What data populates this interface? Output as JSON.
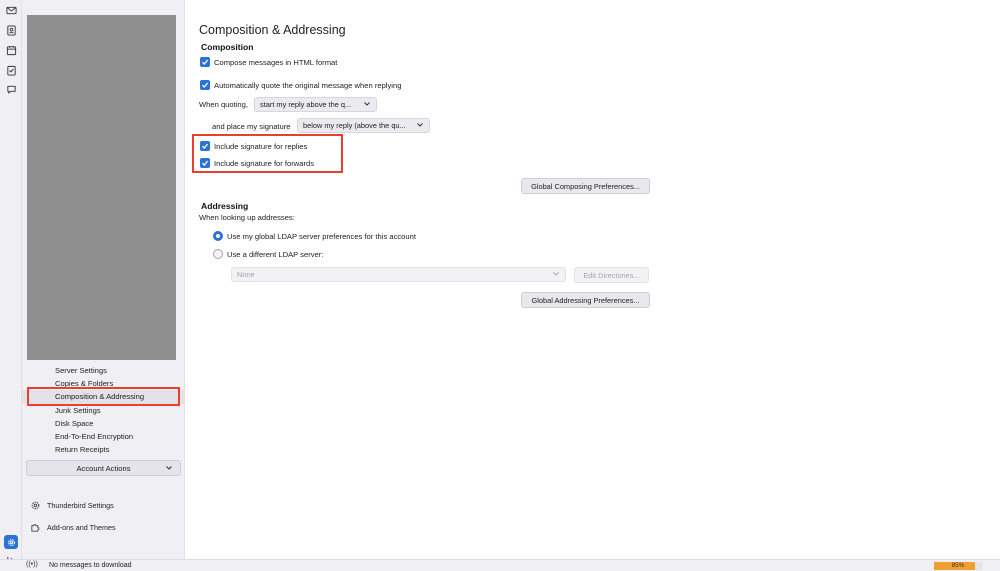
{
  "spaces": {
    "items": [
      {
        "icon": "mail-icon"
      },
      {
        "icon": "address-book-icon"
      },
      {
        "icon": "calendar-icon"
      },
      {
        "icon": "tasks-icon"
      },
      {
        "icon": "chat-icon"
      }
    ],
    "settings_icon": "settings-gear-icon",
    "collapse_icon": "collapse-arrow-icon"
  },
  "sidebar": {
    "nav_items": [
      {
        "label": "Server Settings"
      },
      {
        "label": "Copies & Folders"
      },
      {
        "label": "Composition & Addressing"
      },
      {
        "label": "Junk Settings"
      },
      {
        "label": "Disk Space"
      },
      {
        "label": "End-To-End Encryption"
      },
      {
        "label": "Return Receipts"
      }
    ],
    "selected_index": 2,
    "account_actions": "Account Actions",
    "thunderbird_settings": "Thunderbird Settings",
    "addons": "Add-ons and Themes"
  },
  "page": {
    "title": "Composition & Addressing",
    "composition": {
      "heading": "Composition",
      "html_format": "Compose messages in HTML format",
      "auto_quote": "Automatically quote the original message when replying",
      "when_quoting_label": "When quoting,",
      "when_quoting_value": "start my reply above the q...",
      "place_signature_label": "and place my signature",
      "place_signature_value": "below my reply (above the qu...",
      "sig_replies": "Include signature for replies",
      "sig_forwards": "Include signature for forwards",
      "global_composing_button": "Global Composing Preferences..."
    },
    "addressing": {
      "heading": "Addressing",
      "lookup_label": "When looking up addresses:",
      "use_global": "Use my global LDAP server preferences for this account",
      "use_different": "Use a different LDAP server:",
      "ldap_value": "None",
      "edit_directories": "Edit Directories...",
      "global_addressing_button": "Global Addressing Preferences..."
    }
  },
  "status": {
    "text": "No messages to download",
    "progress_label": "85%",
    "progress_value": 0.85,
    "accent_color": "#f0a030"
  },
  "colors": {
    "accent": "#2b72d7",
    "highlight": "#e8402f"
  }
}
